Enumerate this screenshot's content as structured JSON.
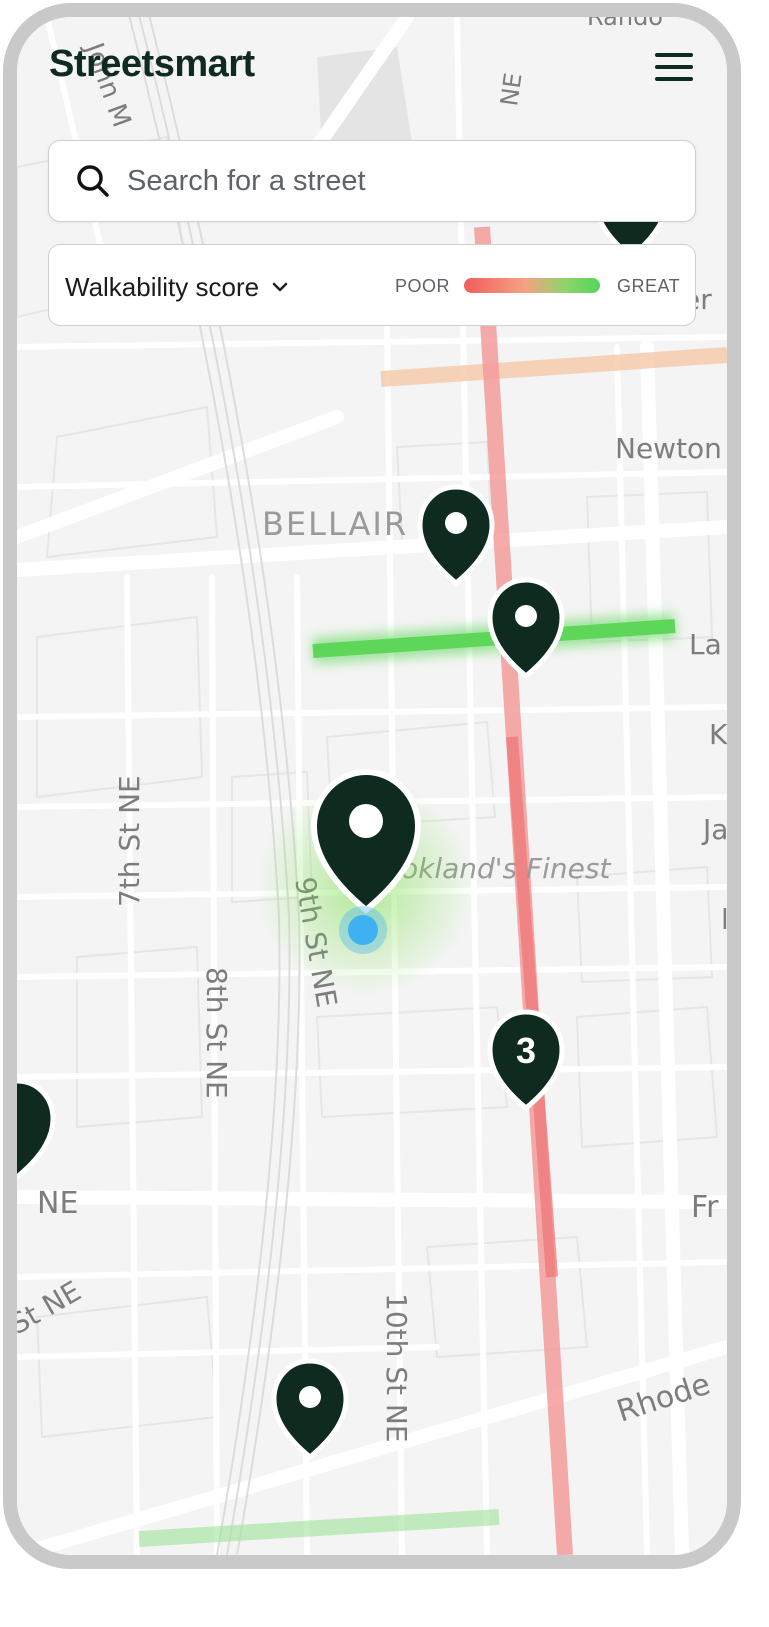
{
  "app": {
    "title": "Streetsmart"
  },
  "search": {
    "placeholder": "Search for a street"
  },
  "legend": {
    "metric": "Walkability score",
    "low_label": "POOR",
    "high_label": "GREAT"
  },
  "map": {
    "labels": {
      "neighborhood": "BELLAIR",
      "place": "okland's Finest",
      "newton": "Newton",
      "la": "La",
      "k": "K",
      "ja": "Ja",
      "l": "l",
      "fr": "Fr",
      "rhode": "Rhode",
      "ne": "NE",
      "st_ne": "St NE",
      "seventh": "7th St NE",
      "eighth": "8th St NE",
      "ninth": "9th St NE",
      "tenth": "10th St NE",
      "john": "John M",
      "top_ne": "NE",
      "er": "er",
      "top_right": "Rando"
    },
    "cluster_count": "3"
  },
  "colors": {
    "brand": "#0f2a1f",
    "poor": "#f25d5d",
    "great": "#52d65a",
    "location": "#3fb0f0"
  },
  "icons": {
    "menu": "hamburger-icon",
    "search": "search-icon",
    "chevron": "chevron-down-icon",
    "pin": "map-pin-icon",
    "location": "current-location-icon"
  }
}
